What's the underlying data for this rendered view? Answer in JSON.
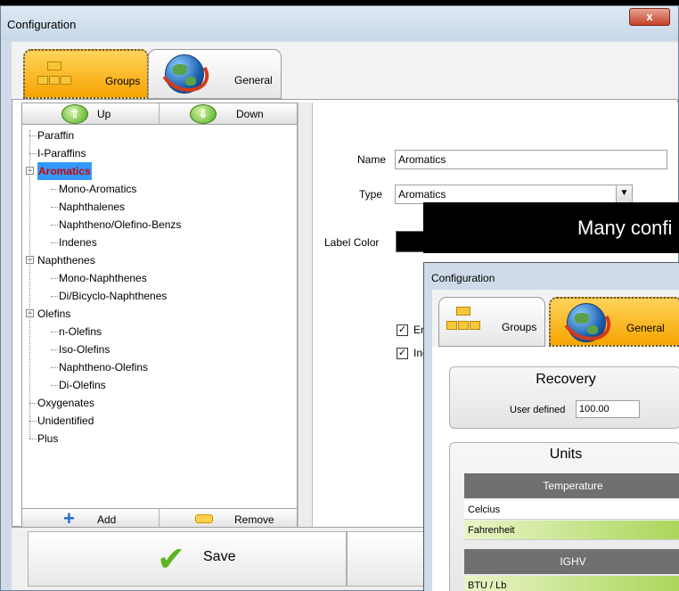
{
  "window": {
    "title": "Configuration",
    "close_label": "x"
  },
  "tabs": {
    "groups": "Groups",
    "general": "General"
  },
  "tree_toolbar": {
    "up": "Up",
    "down": "Down",
    "add": "Add",
    "remove": "Remove"
  },
  "tree": [
    {
      "label": "Paraffin",
      "level": 0
    },
    {
      "label": "I-Paraffins",
      "level": 0
    },
    {
      "label": "Aromatics",
      "level": 0,
      "expanded": true,
      "selected": true
    },
    {
      "label": "Mono-Aromatics",
      "level": 1
    },
    {
      "label": "Naphthalenes",
      "level": 1
    },
    {
      "label": "Naphtheno/Olefino-Benzs",
      "level": 1
    },
    {
      "label": "Indenes",
      "level": 1
    },
    {
      "label": "Naphthenes",
      "level": 0,
      "expanded": true
    },
    {
      "label": "Mono-Naphthenes",
      "level": 1
    },
    {
      "label": "Di/Bicyclo-Naphthenes",
      "level": 1
    },
    {
      "label": "Olefins",
      "level": 0,
      "expanded": true
    },
    {
      "label": "n-Olefins",
      "level": 1
    },
    {
      "label": "Iso-Olefins",
      "level": 1
    },
    {
      "label": "Naphtheno-Olefins",
      "level": 1
    },
    {
      "label": "Di-Olefins",
      "level": 1
    },
    {
      "label": "Oxygenates",
      "level": 0
    },
    {
      "label": "Unidentified",
      "level": 0
    },
    {
      "label": "Plus",
      "level": 0
    }
  ],
  "form": {
    "name_label": "Name",
    "name_value": "Aromatics",
    "type_label": "Type",
    "type_value": "Aromatics",
    "label_color_label": "Label Color",
    "label_color": "#000000",
    "check1_label": "Ena",
    "check2_label": "Incl"
  },
  "save_label": "Save",
  "banner_text": "Many confi",
  "inner": {
    "title": "Configuration",
    "tabs": {
      "groups": "Groups",
      "general": "General"
    },
    "recovery_title": "Recovery",
    "user_defined_label": "User defined",
    "user_defined_value": "100.00",
    "units_title": "Units",
    "temperature_header": "Temperature",
    "temperature_options": [
      "Celcius",
      "Fahrenheit"
    ],
    "ighv_header": "IGHV",
    "ighv_option": "BTU / Lb"
  },
  "colors": {
    "accent_tab": "#f6a400",
    "selection": "#3399ff",
    "selected_text": "#cc0000"
  }
}
